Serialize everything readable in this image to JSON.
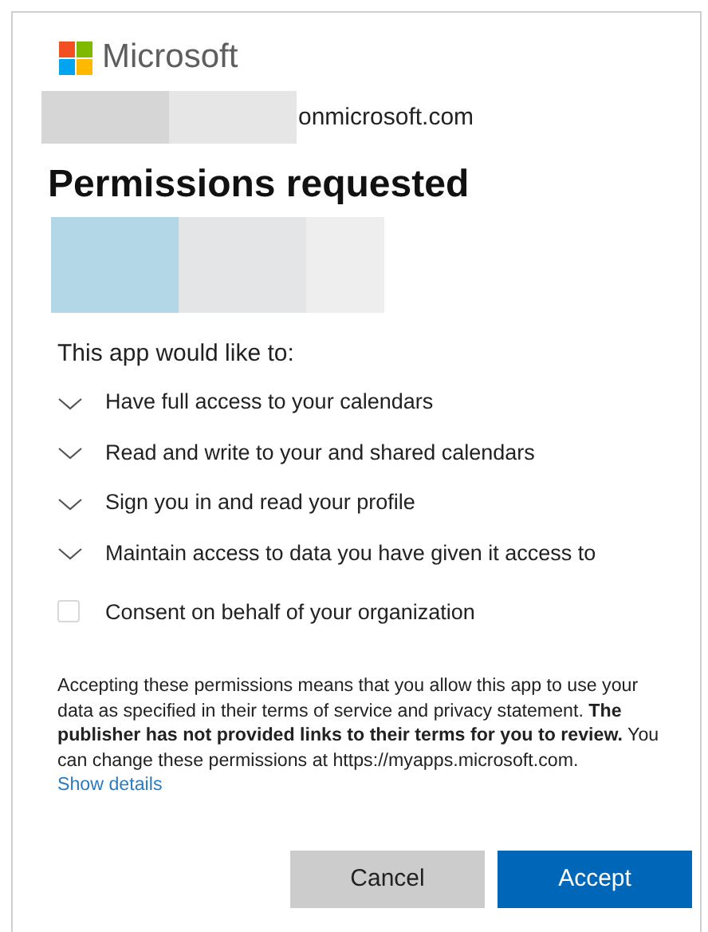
{
  "brand": {
    "name": "Microsoft"
  },
  "account": {
    "domain_suffix": "onmicrosoft.com"
  },
  "title": "Permissions requested",
  "intro": "This app would like to:",
  "items": [
    {
      "kind": "permission",
      "label": "Have full access to your calendars",
      "expanded": false
    },
    {
      "kind": "permission",
      "label": "Read and write to your and shared calendars",
      "expanded": false
    },
    {
      "kind": "permission",
      "label": "Sign you in and read your profile",
      "expanded": false
    },
    {
      "kind": "permission",
      "label": "Maintain access to data you have given it access to",
      "expanded": false
    },
    {
      "kind": "checkbox",
      "label": "Consent on behalf of your organization",
      "checked": false
    }
  ],
  "notice": {
    "text": "Accepting these permissions means that you allow this app to use your data as specified in their terms of service and privacy statement. **The publisher has not provided links to their terms for you to review.** You can change these permissions at https://myapps.microsoft.com.",
    "link": "Show details"
  },
  "buttons": [
    {
      "kind": "secondary",
      "label": "Cancel"
    },
    {
      "kind": "primary",
      "label": "Accept"
    }
  ]
}
